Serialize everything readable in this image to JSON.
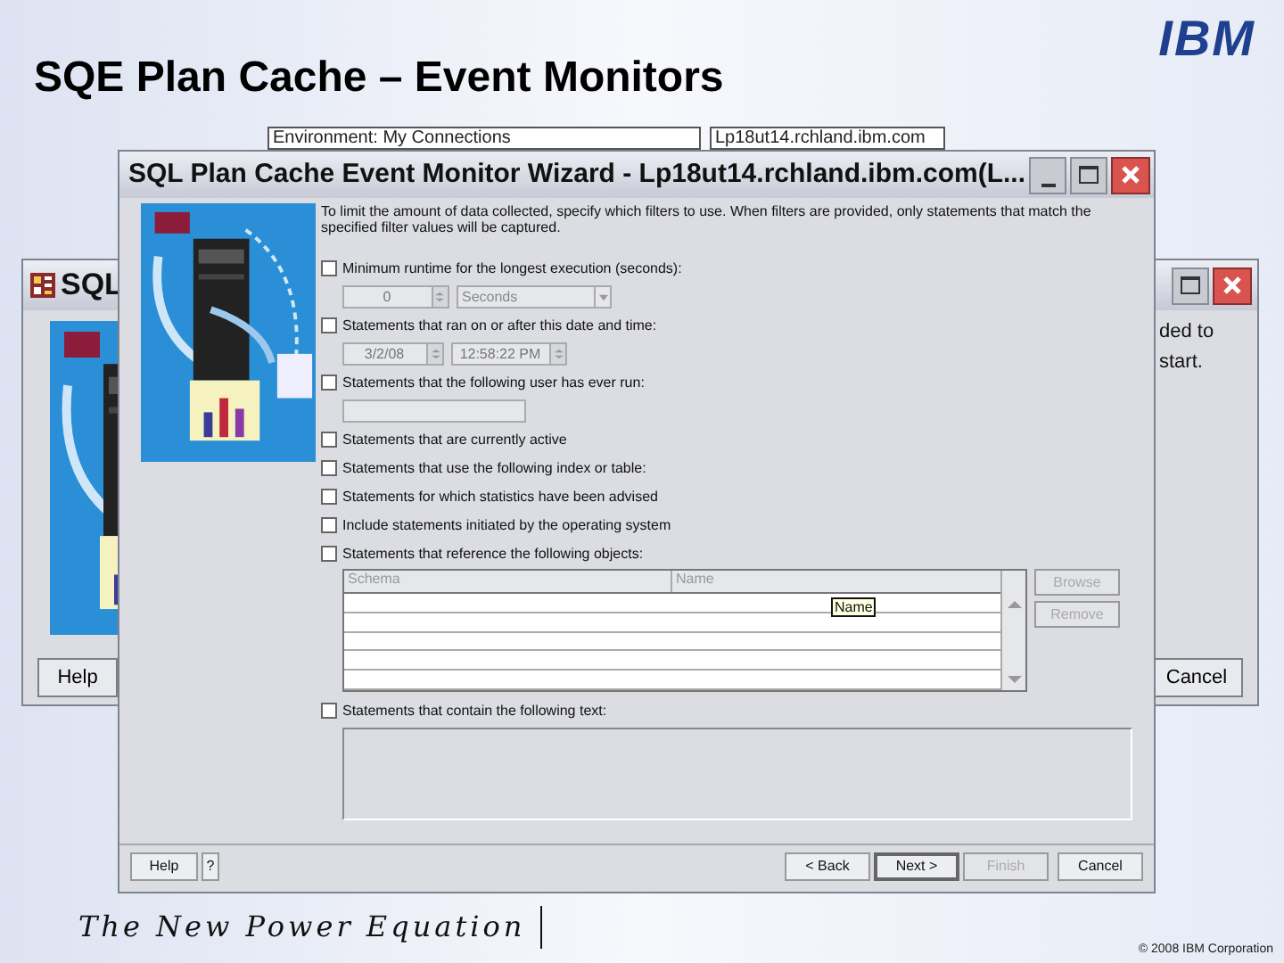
{
  "slide_title": "SQE Plan Cache – Event Monitors",
  "logo": "IBM",
  "background_fields": [
    "Environment: My Connections",
    "Lp18ut14.rchland.ibm.com"
  ],
  "back_window": {
    "title": "SQL",
    "text": "ded to start.",
    "buttons": [
      "Help",
      "Cancel"
    ]
  },
  "wizard": {
    "title": "SQL Plan Cache Event Monitor Wizard - Lp18ut14.rchland.ibm.com(L...",
    "intro": "To limit the amount of data collected, specify which filters to use. When filters are provided, only statements that match the specified filter values will be captured.",
    "filters": [
      {
        "kind": "runtime",
        "label": "Minimum runtime for the longest execution (seconds):",
        "checked": false,
        "value": "0",
        "unit": "Seconds"
      },
      {
        "kind": "datetime",
        "label": "Statements that ran on or after this date and time:",
        "checked": false,
        "date": "3/2/08",
        "time": "12:58:22 PM"
      },
      {
        "kind": "user",
        "label": "Statements that the following user has ever run:",
        "checked": false
      },
      {
        "kind": "plain",
        "label": "Statements that are currently active",
        "checked": false
      },
      {
        "kind": "plain",
        "label": "Statements that use the following index or table:",
        "checked": false
      },
      {
        "kind": "plain",
        "label": "Statements for which statistics have been advised",
        "checked": false
      },
      {
        "kind": "plain",
        "label": "Include statements initiated by the operating system",
        "checked": false
      },
      {
        "kind": "objects",
        "label": "Statements that reference the following objects:",
        "checked": false,
        "columns": [
          "Schema",
          "Name"
        ],
        "tooltip": "Name",
        "buttons": [
          {
            "label": "Browse",
            "disabled": true
          },
          {
            "label": "Remove",
            "disabled": true
          }
        ]
      },
      {
        "kind": "text",
        "label": "Statements that contain the following text:",
        "checked": false
      }
    ],
    "buttons": [
      {
        "label": "Help",
        "disabled": false,
        "default": false
      },
      {
        "label": "?",
        "disabled": false,
        "default": false
      },
      {
        "label": "< Back",
        "disabled": false,
        "default": false
      },
      {
        "label": "Next >",
        "disabled": false,
        "default": true
      },
      {
        "label": "Finish",
        "disabled": true,
        "default": false
      },
      {
        "label": "Cancel",
        "disabled": false,
        "default": false
      }
    ]
  },
  "footer": {
    "tagline": "The New Power Equation",
    "copyright": "© 2008 IBM Corporation"
  }
}
